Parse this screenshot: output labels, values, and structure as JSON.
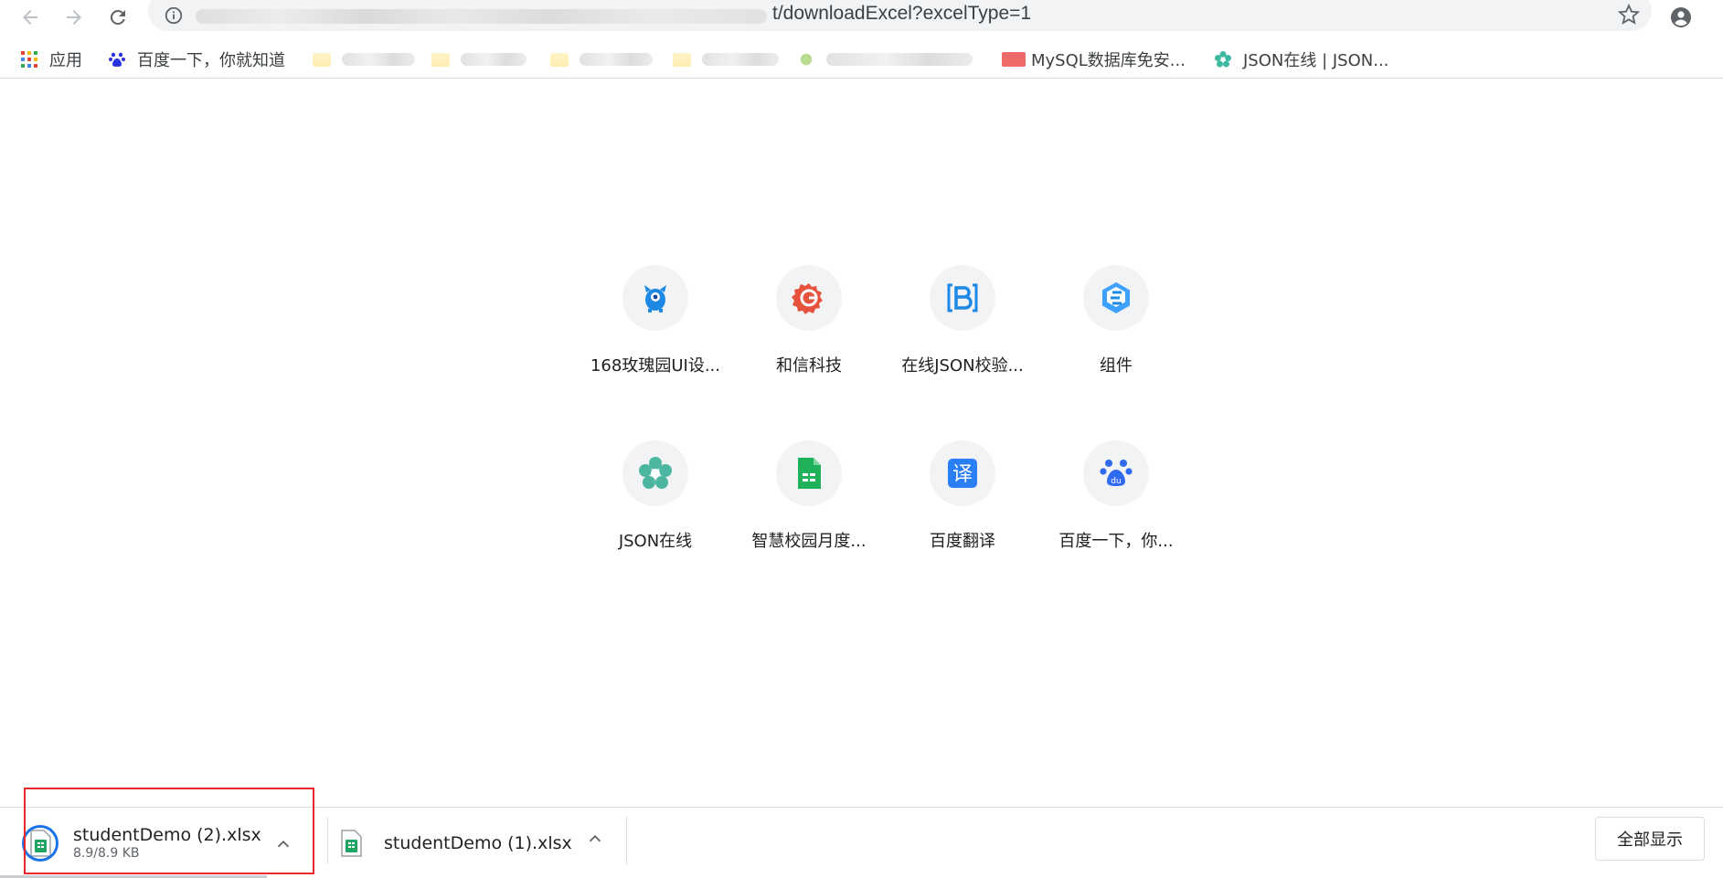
{
  "omnibox": {
    "url_visible": "t/downloadExcel?excelType=1"
  },
  "bookmarks": {
    "items": [
      {
        "label": "应用",
        "icon": "apps-grid-icon"
      },
      {
        "label": "百度一下，你就知道",
        "icon": "baidu-paw-icon"
      },
      {
        "label": "MySQL数据库免安...",
        "icon": "mysql-icon"
      },
      {
        "label": "JSON在线 | JSON...",
        "icon": "json-flower-icon"
      }
    ]
  },
  "tiles": [
    {
      "label": "168玫瑰园UI设...",
      "icon": "blue-monster-icon"
    },
    {
      "label": "和信科技",
      "icon": "red-gear-icon"
    },
    {
      "label": "在线JSON校验...",
      "icon": "bracket-b-icon"
    },
    {
      "label": "组件",
      "icon": "blue-hexagon-icon"
    },
    {
      "label": "JSON在线",
      "icon": "json-flower-icon"
    },
    {
      "label": "智慧校园月度...",
      "icon": "green-sheet-icon"
    },
    {
      "label": "百度翻译",
      "icon": "translate-icon"
    },
    {
      "label": "百度一下，你...",
      "icon": "baidu-paw-icon"
    }
  ],
  "downloads": {
    "items": [
      {
        "name": "studentDemo (2).xlsx",
        "size": "8.9/8.9 KB",
        "progress": 1.0
      },
      {
        "name": "studentDemo (1).xlsx"
      }
    ],
    "show_all_label": "全部显示"
  },
  "colors": {
    "highlight": "#e8282b",
    "accent": "#1a73e8"
  }
}
